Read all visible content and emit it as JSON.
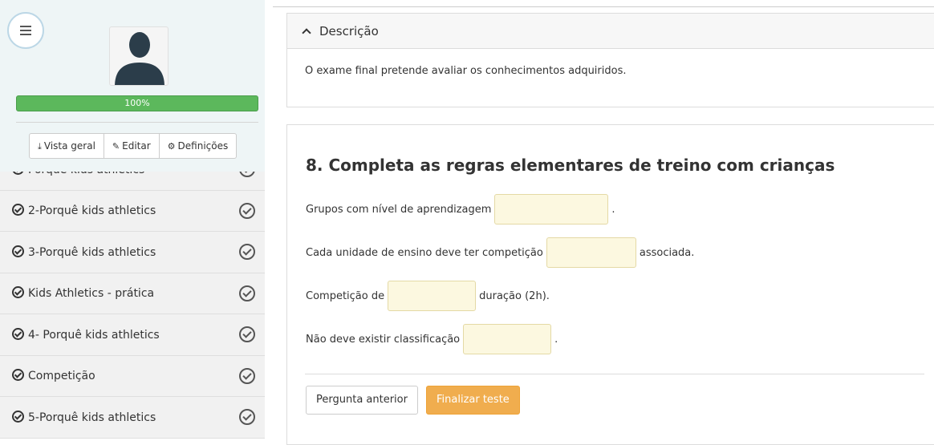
{
  "sidebar": {
    "progress_label": "100%",
    "progress": 1.0,
    "buttons": [
      {
        "icon": "download-icon",
        "label": "Vista geral"
      },
      {
        "icon": "pencil-icon",
        "label": "Editar"
      },
      {
        "icon": "gear-icon",
        "label": "Definições"
      }
    ],
    "items": [
      {
        "label": "Porquê kids athletics"
      },
      {
        "label": "2-Porquê kids athletics"
      },
      {
        "label": "3-Porquê kids athletics"
      },
      {
        "label": "Kids Athletics - prática"
      },
      {
        "label": "4- Porquê kids athletics"
      },
      {
        "label": "Competição"
      },
      {
        "label": "5-Porquê kids athletics"
      }
    ]
  },
  "description": {
    "heading": "Descrição",
    "text": "O exame final pretende avaliar os conhecimentos adquiridos."
  },
  "question": {
    "title": "8. Completa as regras elementares de treino com crianças",
    "lines": [
      {
        "before": "Grupos com nível de aprendizagem",
        "after": "."
      },
      {
        "before": "Cada unidade de ensino deve ter competição",
        "after": "associada."
      },
      {
        "before": "Competição de",
        "after": "duração (2h)."
      },
      {
        "before": "Não deve existir classificação",
        "after": "."
      }
    ],
    "prev_label": "Pergunta anterior",
    "finish_label": "Finalizar teste"
  },
  "colors": {
    "progress": "#5cb85c",
    "finish_button": "#f0ad4e",
    "blank_fill": "#fcf8e0"
  }
}
